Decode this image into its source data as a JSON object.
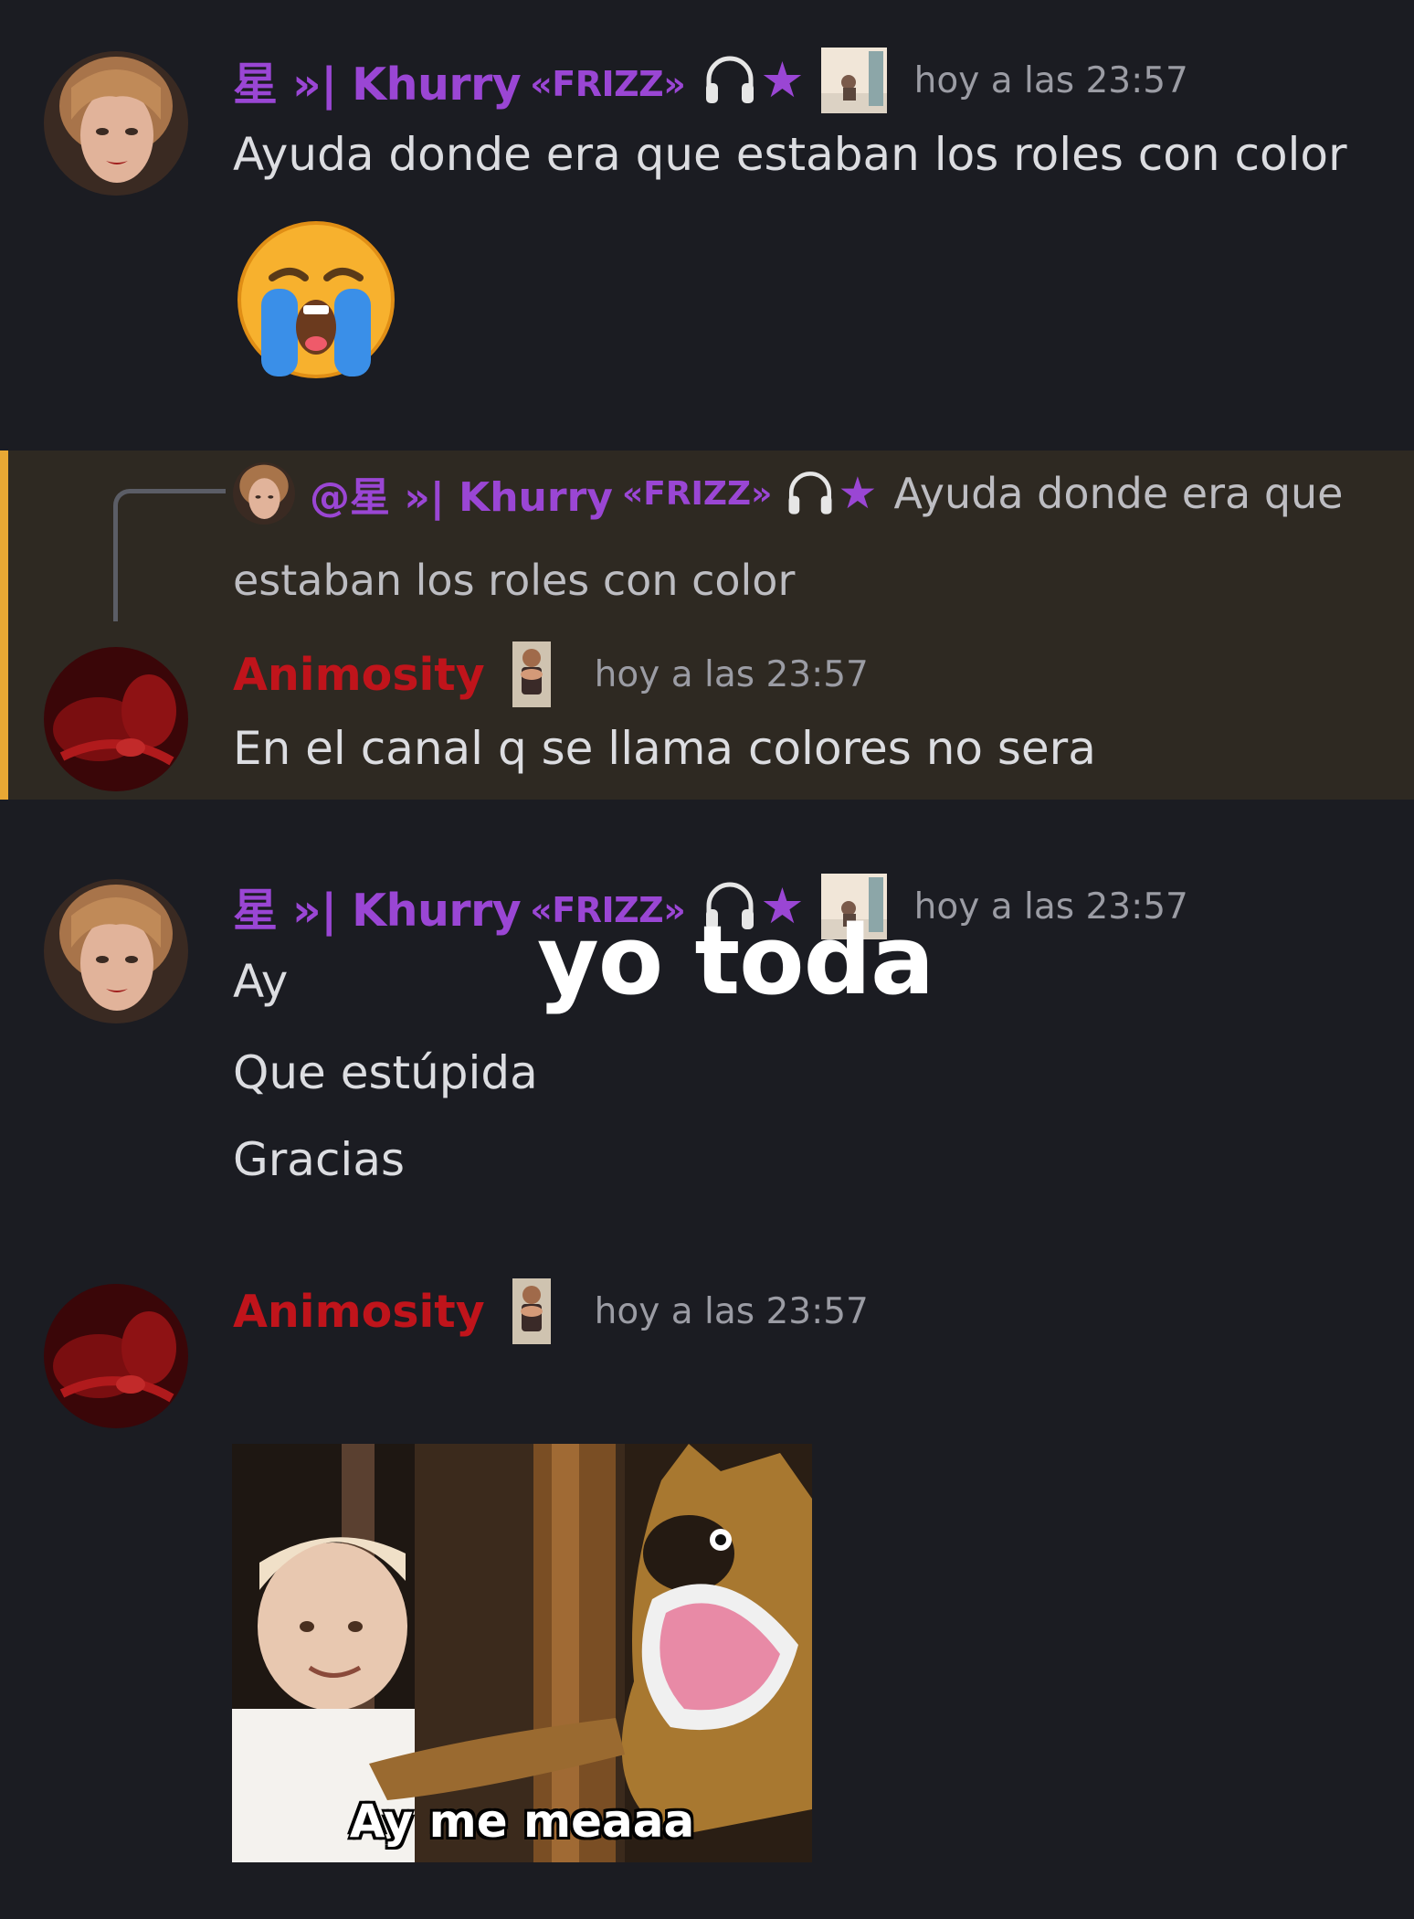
{
  "messages": [
    {
      "author": "星 »| Khurry",
      "author_tag": "«FRIZZ»",
      "timestamp": "hoy a las 23:57",
      "text": "Ayuda donde era que estaban los roles con color",
      "reaction_emoji": "loudly-crying-face"
    },
    {
      "reply_to": {
        "mention": "@星 »| Khurry",
        "tag": "«FRIZZ»",
        "text_line1": "Ayuda donde era que",
        "text_line2": "estaban los roles con color"
      },
      "author": "Animosity",
      "timestamp": "hoy a las 23:57",
      "text": "En el canal q se llama colores no sera"
    },
    {
      "author": "星 »| Khurry",
      "author_tag": "«FRIZZ»",
      "timestamp": "hoy a las 23:57",
      "lines": [
        "Ay",
        "Que estúpida",
        "Gracias"
      ]
    },
    {
      "author": "Animosity",
      "timestamp": "hoy a las 23:57",
      "image_caption": "Ay me meaaa"
    }
  ],
  "overlay_text": "yo toda",
  "colors": {
    "background": "#1b1c22",
    "highlight_bg": "#2e2922",
    "highlight_bar": "#e9a834",
    "khurry_color": "#9a46d4",
    "animosity_color": "#c0141b",
    "timestamp_color": "#9b9ca4"
  }
}
